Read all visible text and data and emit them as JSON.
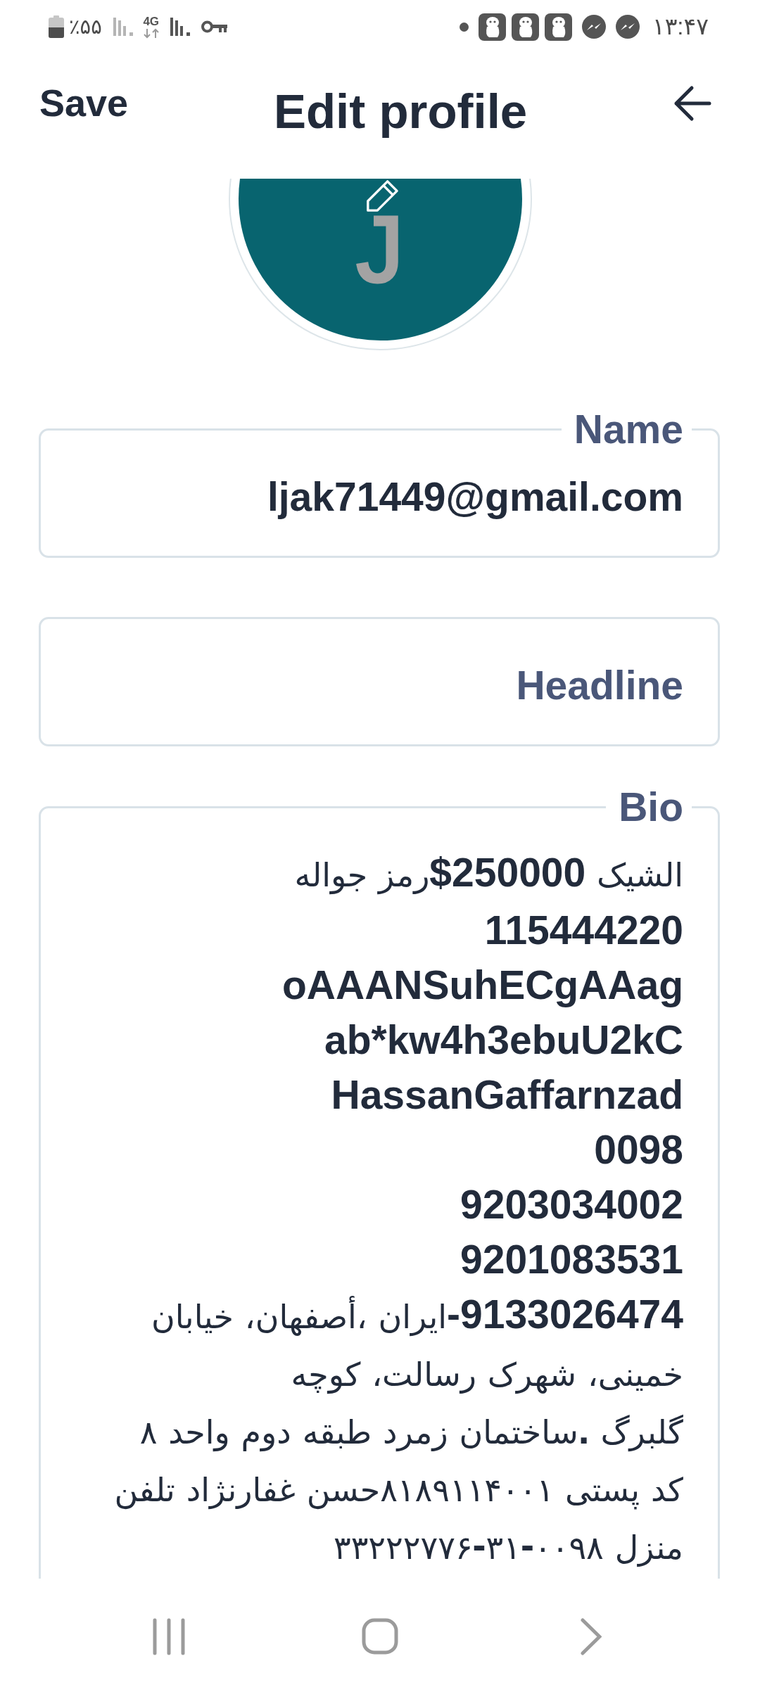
{
  "status_bar": {
    "battery": "٪۵۵",
    "network": "4G",
    "time": "۱۳:۴۷"
  },
  "header": {
    "save": "Save",
    "title": "Edit profile"
  },
  "avatar": {
    "initial": "J"
  },
  "fields": [
    {
      "kind": "text",
      "label": "Name",
      "value": "ljak71449@gmail.com"
    },
    {
      "kind": "text",
      "placeholder": "Headline"
    },
    {
      "kind": "multiline",
      "label": "Bio",
      "value": "الشیک 250000$رمز جواله\n115444220\noAAANSuhECgAAag\nab*kw4h3ebuU2kC\nHassanGaffarnzad\n0098\n9203034002\n9201083531\n9133026474-ایران ،أصفهان، خیابان\nخمینی، شهرک رسالت، کوچه\nگلبرگ .ساختمان زمرد طبقه دوم واحد ۸\nکد پستی ۸۱۸۹۱۱۴۰۰۱حسن غفارنژاد تلفن\nمنزل ۰۰۹۸-۳۱-۳۳۲۲۲۷۷۶"
    }
  ]
}
